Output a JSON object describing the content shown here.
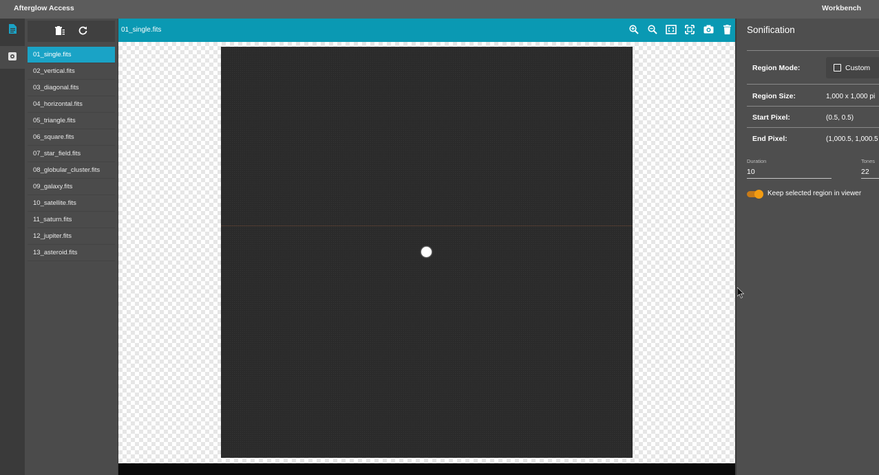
{
  "topbar": {
    "app_title": "Afterglow Access",
    "workbench": "Workbench"
  },
  "rail": {
    "items": [
      {
        "icon": "file-icon",
        "active": true
      },
      {
        "icon": "settings-icon",
        "active": false
      }
    ]
  },
  "files": {
    "toolbar": {
      "icons": [
        "close-files-icon",
        "refresh-icon"
      ]
    },
    "items": [
      {
        "label": "01_single.fits",
        "selected": true
      },
      {
        "label": "02_vertical.fits"
      },
      {
        "label": "03_diagonal.fits"
      },
      {
        "label": "04_horizontal.fits"
      },
      {
        "label": "05_triangle.fits"
      },
      {
        "label": "06_square.fits"
      },
      {
        "label": "07_star_field.fits"
      },
      {
        "label": "08_globular_cluster.fits"
      },
      {
        "label": "09_galaxy.fits"
      },
      {
        "label": "10_satellite.fits"
      },
      {
        "label": "11_saturn.fits"
      },
      {
        "label": "12_jupiter.fits"
      },
      {
        "label": "13_asteroid.fits"
      }
    ]
  },
  "viewer": {
    "tab_label": "01_single.fits",
    "tools": [
      "zoom-in-icon",
      "zoom-out-icon",
      "zoom-to-fit-icon",
      "actual-size-icon",
      "snapshot-icon",
      "delete-icon"
    ],
    "accent": "#0a99b3"
  },
  "sonification": {
    "title": "Sonification",
    "region_mode": {
      "label": "Region Mode:",
      "button": "Custom"
    },
    "region_size": {
      "label": "Region Size:",
      "value": "1,000 x 1,000 pi"
    },
    "start_pixel": {
      "label": "Start Pixel:",
      "value": "(0.5, 0.5)"
    },
    "end_pixel": {
      "label": "End Pixel:",
      "value": "(1,000.5, 1,000.5"
    },
    "duration": {
      "label": "Duration",
      "value": "10"
    },
    "tones": {
      "label": "Tones",
      "value": "22"
    },
    "keep_region": {
      "label": "Keep selected region in viewer",
      "on": true,
      "color": "#f39c12"
    }
  }
}
